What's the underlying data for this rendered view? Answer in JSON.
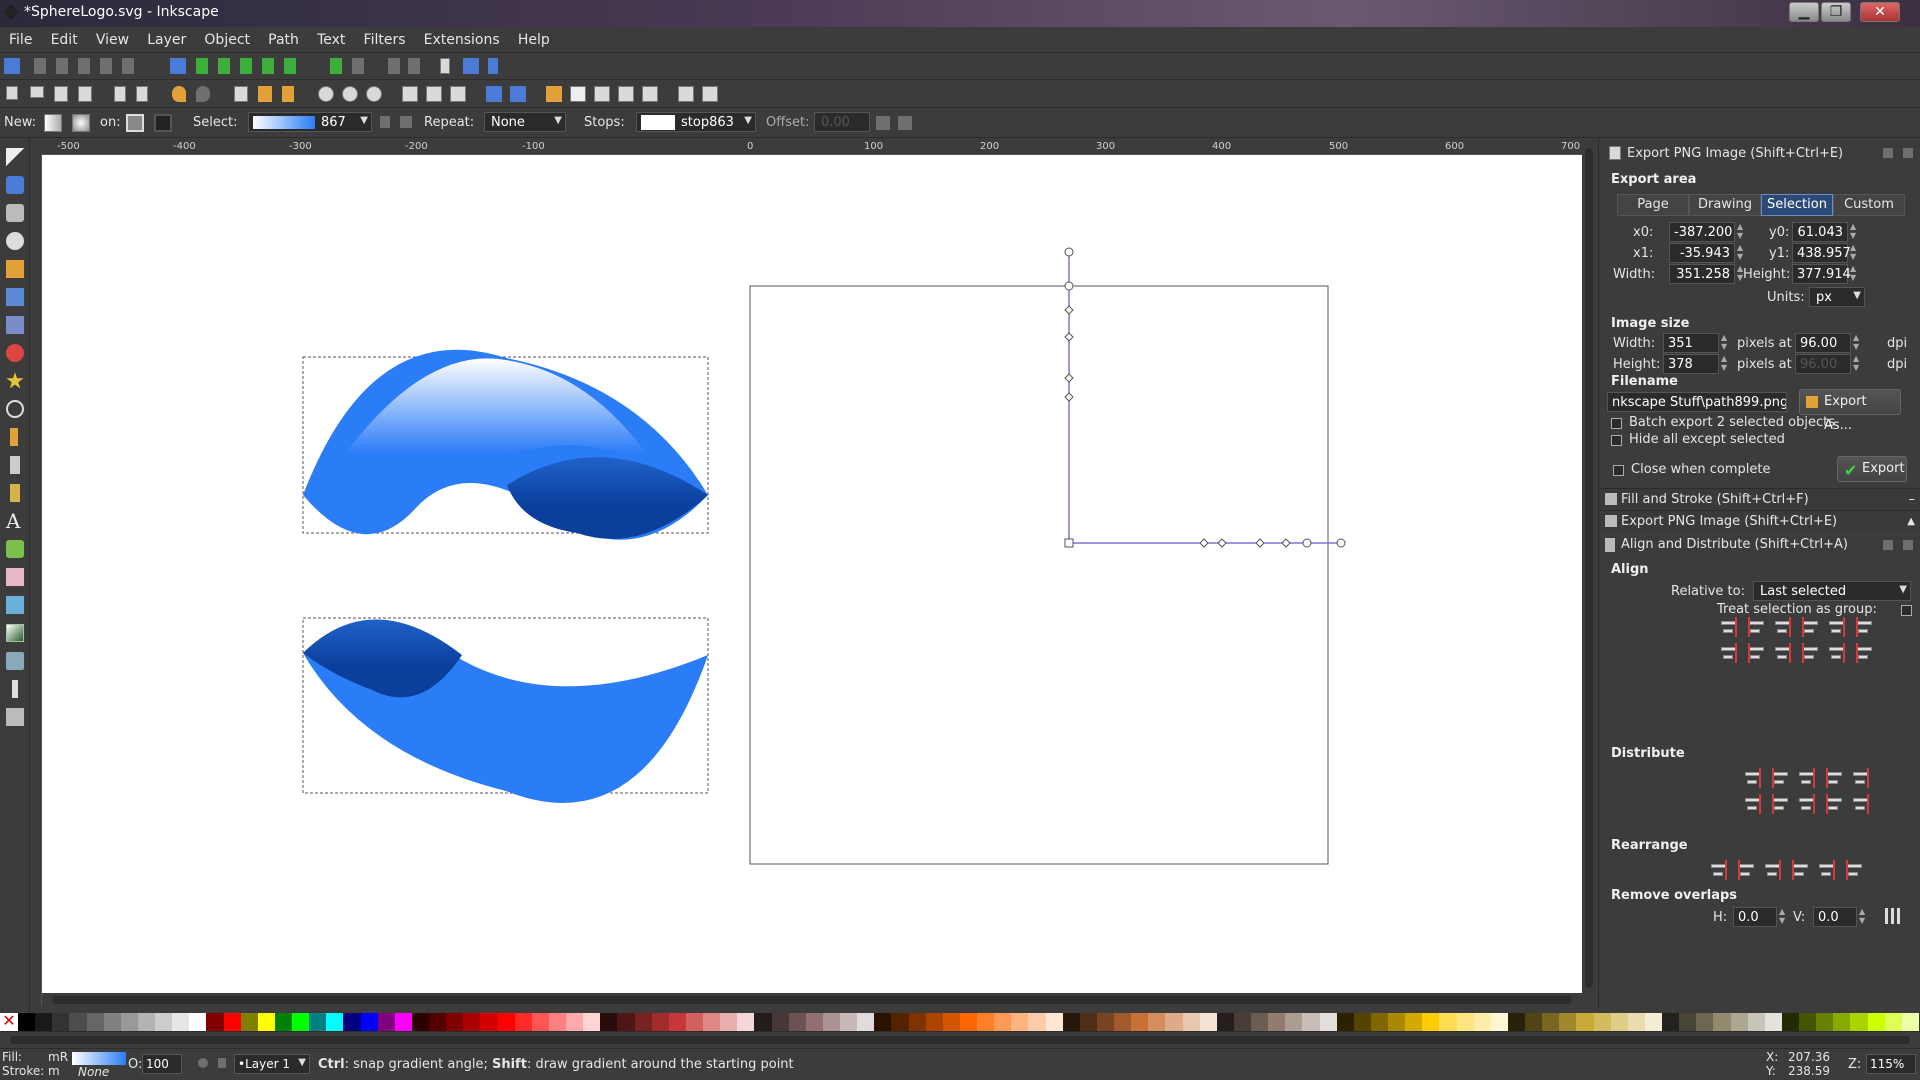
{
  "window": {
    "title": "*SphereLogo.svg - Inkscape"
  },
  "menu": [
    "File",
    "Edit",
    "View",
    "Layer",
    "Object",
    "Path",
    "Text",
    "Filters",
    "Extensions",
    "Help"
  ],
  "gradient_toolbar": {
    "new_label": "New:",
    "on_label": "on:",
    "select_label": "Select:",
    "select_value": "867",
    "repeat_label": "Repeat:",
    "repeat_value": "None",
    "stops_label": "Stops:",
    "stops_value": "stop863",
    "offset_label": "Offset:",
    "offset_value": "0.00"
  },
  "ruler_ticks": [
    "-500",
    "-400",
    "-300",
    "-200",
    "-100",
    "0",
    "100",
    "200",
    "300",
    "400",
    "500",
    "600",
    "700"
  ],
  "export_panel": {
    "header": "Export PNG Image (Shift+Ctrl+E)",
    "export_area_title": "Export area",
    "tabs": [
      "Page",
      "Drawing",
      "Selection",
      "Custom"
    ],
    "active_tab": "Selection",
    "x0_label": "x0:",
    "x0": "-387.200",
    "y0_label": "y0:",
    "y0": "61.043",
    "x1_label": "x1:",
    "x1": "-35.943",
    "y1_label": "y1:",
    "y1": "438.957",
    "width_label": "Width:",
    "width": "351.258",
    "height_label": "Height:",
    "height": "377.914",
    "units_label": "Units:",
    "units": "px",
    "image_size_title": "Image size",
    "img_width_label": "Width:",
    "img_width": "351",
    "img_height_label": "Height:",
    "img_height": "378",
    "pixels_at": "pixels at",
    "dpi_value": "96.00",
    "dpi_value2": "96.00",
    "dpi_label": "dpi",
    "filename_title": "Filename",
    "filename": "nkscape Stuff\\path899.png",
    "export_as": "Export As...",
    "batch_export": "Batch export 2 selected objects",
    "hide_except": "Hide all except selected",
    "close_when_complete": "Close when complete",
    "export_button": "Export"
  },
  "dock": {
    "fill_stroke": "Fill and Stroke (Shift+Ctrl+F)",
    "export_png": "Export PNG Image (Shift+Ctrl+E)",
    "align_distribute": "Align and Distribute (Shift+Ctrl+A)"
  },
  "align_panel": {
    "align_title": "Align",
    "relative_to_label": "Relative to:",
    "relative_to": "Last selected",
    "treat_group": "Treat selection as group:",
    "distribute_title": "Distribute",
    "rearrange_title": "Rearrange",
    "remove_overlaps_title": "Remove overlaps",
    "h_label": "H:",
    "h_value": "0.0",
    "v_label": "V:",
    "v_value": "0.0"
  },
  "status": {
    "fill_label": "Fill:",
    "stroke_label": "Stroke:",
    "fill_indicator": "mR",
    "stroke_indicator": "m",
    "stroke_value": "None",
    "opacity_label": "O:",
    "opacity": "100",
    "layer": "•Layer 1",
    "message_key1": "Ctrl",
    "message_part1": ": snap gradient angle; ",
    "message_key2": "Shift",
    "message_part2": ": draw gradient around the starting point",
    "x_label": "X:",
    "x": "207.36",
    "y_label": "Y:",
    "y": "238.59",
    "z_label": "Z:",
    "zoom": "115%"
  },
  "colors": {
    "accent_blue": "#2b7cf7",
    "dark_blue": "#0b3f9c",
    "guide_purple": "#7a75d6"
  },
  "palette": [
    "#000000",
    "#1a1a1a",
    "#333333",
    "#4d4d4d",
    "#666666",
    "#808080",
    "#999999",
    "#b3b3b3",
    "#cccccc",
    "#e6e6e6",
    "#ffffff",
    "#800000",
    "#ff0000",
    "#808000",
    "#ffff00",
    "#008000",
    "#00ff00",
    "#008080",
    "#00ffff",
    "#000080",
    "#0000ff",
    "#800080",
    "#ff00ff",
    "#2b0000",
    "#550000",
    "#800000",
    "#aa0000",
    "#d40000",
    "#ff0000",
    "#ff2a2a",
    "#ff5555",
    "#ff8080",
    "#ffaaaa",
    "#ffd5d5",
    "#280b0b",
    "#501616",
    "#782121",
    "#a02c2c",
    "#c83737",
    "#d35f5f",
    "#de8787",
    "#e9afaf",
    "#f4d7d7",
    "#241c1c",
    "#483737",
    "#6c5353",
    "#916f6f",
    "#ac9393",
    "#c8b7b7",
    "#e3dbdb",
    "#2b1100",
    "#552200",
    "#803300",
    "#aa4400",
    "#d45500",
    "#ff6600",
    "#ff7f2a",
    "#ff9955",
    "#ffb380",
    "#ffccaa",
    "#ffe6d5",
    "#28170b",
    "#502d16",
    "#784421",
    "#a05a2c",
    "#c87137",
    "#d38d5f",
    "#deaa87",
    "#e9c6af",
    "#f4e3d7",
    "#241f1c",
    "#483e37",
    "#6c5d53",
    "#917c6f",
    "#ac9d93",
    "#c8beb7",
    "#e3dedb",
    "#2b2200",
    "#554400",
    "#806600",
    "#aa8800",
    "#d4aa00",
    "#ffcc00",
    "#ffdd55",
    "#ffe680",
    "#ffeeaa",
    "#fff6d5",
    "#28220b",
    "#504416",
    "#786721",
    "#a0892c",
    "#c8ab37",
    "#d3bc5f",
    "#decd87",
    "#e9ddaf",
    "#f4eed7",
    "#24221c",
    "#484537",
    "#6c6753",
    "#918a6f",
    "#aca793",
    "#c8c4b7",
    "#e3e2db",
    "#222b00",
    "#445500",
    "#668000",
    "#88aa00",
    "#aad400",
    "#ccff00",
    "#ddff55",
    "#eeffaa"
  ]
}
